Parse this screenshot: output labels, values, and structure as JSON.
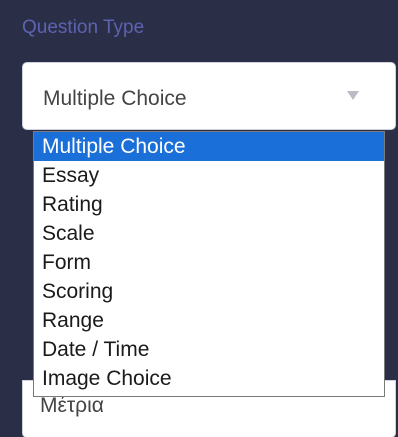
{
  "question_type": {
    "label": "Question Type",
    "selected_value": "Multiple Choice",
    "options": [
      {
        "label": "Multiple Choice",
        "selected": true
      },
      {
        "label": "Essay",
        "selected": false
      },
      {
        "label": "Rating",
        "selected": false
      },
      {
        "label": "Scale",
        "selected": false
      },
      {
        "label": "Form",
        "selected": false
      },
      {
        "label": "Scoring",
        "selected": false
      },
      {
        "label": "Range",
        "selected": false
      },
      {
        "label": "Date / Time",
        "selected": false
      },
      {
        "label": "Image Choice",
        "selected": false
      }
    ]
  },
  "underlying_field": {
    "value": "Μέτρια"
  },
  "colors": {
    "page_background": "#2b2e47",
    "label_color": "#5b63b0",
    "highlight": "#1b6fd8"
  }
}
